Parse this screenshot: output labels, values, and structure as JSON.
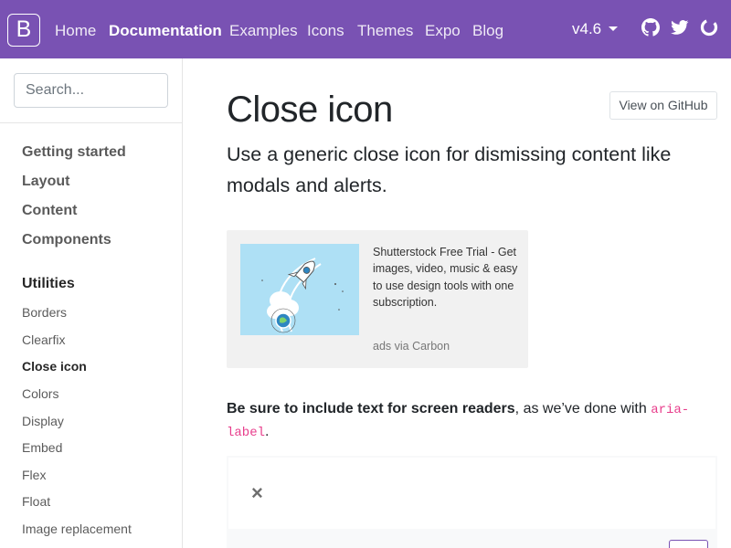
{
  "navbar": {
    "brand": "B",
    "links": [
      "Home",
      "Documentation",
      "Examples",
      "Icons",
      "Themes",
      "Expo",
      "Blog"
    ],
    "active": "Documentation",
    "version": "v4.6",
    "icons": [
      "github-icon",
      "twitter-icon",
      "opencollective-icon"
    ],
    "bg_color": "#7952b3"
  },
  "sidebar": {
    "search": {
      "placeholder": "Search...",
      "value": ""
    },
    "groups": [
      "Getting started",
      "Layout",
      "Content",
      "Components",
      "Utilities"
    ],
    "active_group": "Utilities",
    "items": [
      "Borders",
      "Clearfix",
      "Close icon",
      "Colors",
      "Display",
      "Embed",
      "Flex",
      "Float",
      "Image replacement"
    ],
    "active_item": "Close icon"
  },
  "main": {
    "title": "Close icon",
    "github_button": "View on GitHub",
    "lead": "Use a generic close icon for dismissing content like modals and alerts.",
    "ad": {
      "text": "Shutterstock Free Trial - Get images, video, music & easy to use design tools with one subscription.",
      "poweredby": "ads via Carbon"
    },
    "note": {
      "strong": "Be sure to include text for screen readers",
      "text": ", as we’ve done with ",
      "code": "aria-label",
      "end": "."
    },
    "example": {
      "close_symbol": "×"
    }
  }
}
